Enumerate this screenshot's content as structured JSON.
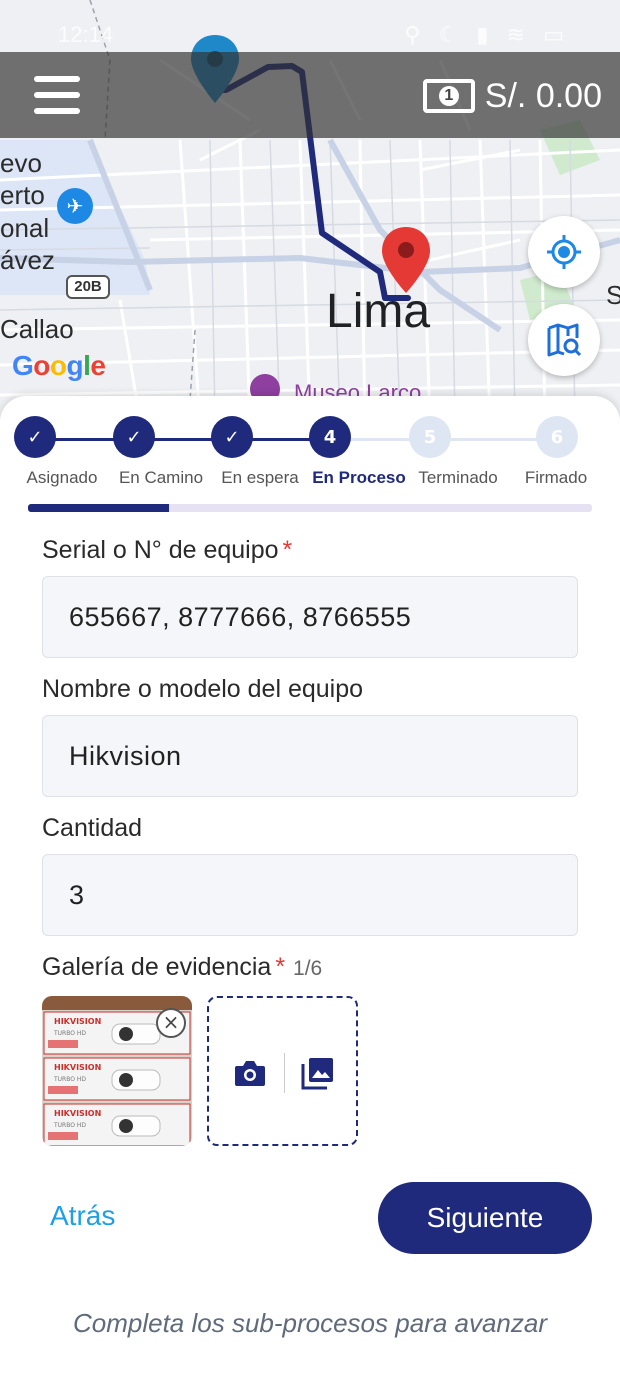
{
  "status_bar": {
    "time": "12:14",
    "icons": "⚲ ☾ ▮ ≋ ▭"
  },
  "map": {
    "city_label": "Lima",
    "district_label": "Callao",
    "airport_partial_lines": [
      "evo",
      "erto",
      "onal",
      "ávez"
    ],
    "highway_shield": "20B",
    "museum_label": "Museo Larco",
    "edge_label": "S",
    "logo_letters": [
      "G",
      "o",
      "o",
      "g",
      "l",
      "e"
    ],
    "logo_colors": [
      "#4285F4",
      "#EA4335",
      "#FBBC05",
      "#4285F4",
      "#34A853",
      "#EA4335"
    ],
    "route_color": "#1f2a7c",
    "origin_pin_color": "#1e88c8",
    "destination_pin_color": "#e53935"
  },
  "topbar": {
    "menu_icon": "hamburger-menu-icon",
    "currency_icon": "banknote-icon",
    "currency_icon_glyph": "1",
    "balance": "S/. 0.00"
  },
  "map_buttons": {
    "locate_icon": "my-location-icon",
    "map_search_icon": "map-search-icon"
  },
  "stepper": {
    "steps": [
      {
        "number": "✓",
        "label": "Asignado",
        "state": "done"
      },
      {
        "number": "✓",
        "label": "En Camino",
        "state": "done"
      },
      {
        "number": "✓",
        "label": "En espera",
        "state": "done"
      },
      {
        "number": "4",
        "label": "En Proceso",
        "state": "active"
      },
      {
        "number": "5",
        "label": "Terminado",
        "state": "todo"
      },
      {
        "number": "6",
        "label": "Firmado",
        "state": "todo"
      }
    ],
    "progress_fraction": 0.25,
    "active_color": "#1f2a7c",
    "inactive_color": "#dfe6f3"
  },
  "form": {
    "serial": {
      "label": "Serial o N° de equipo",
      "required_mark": "*",
      "value": "655667, 8777666, 8766555"
    },
    "model": {
      "label": "Nombre o modelo del equipo",
      "value": "Hikvision"
    },
    "quantity": {
      "label": "Cantidad",
      "value": "3"
    },
    "gallery": {
      "label": "Galería de evidencia",
      "required_mark": "*",
      "count": "1/6",
      "photo_box_texts": [
        "HIKVISION",
        "TURBO HD"
      ],
      "remove_glyph": "×"
    }
  },
  "actions": {
    "back_label": "Atrás",
    "next_label": "Siguiente",
    "hint": "Completa los sub-procesos para avanzar"
  }
}
